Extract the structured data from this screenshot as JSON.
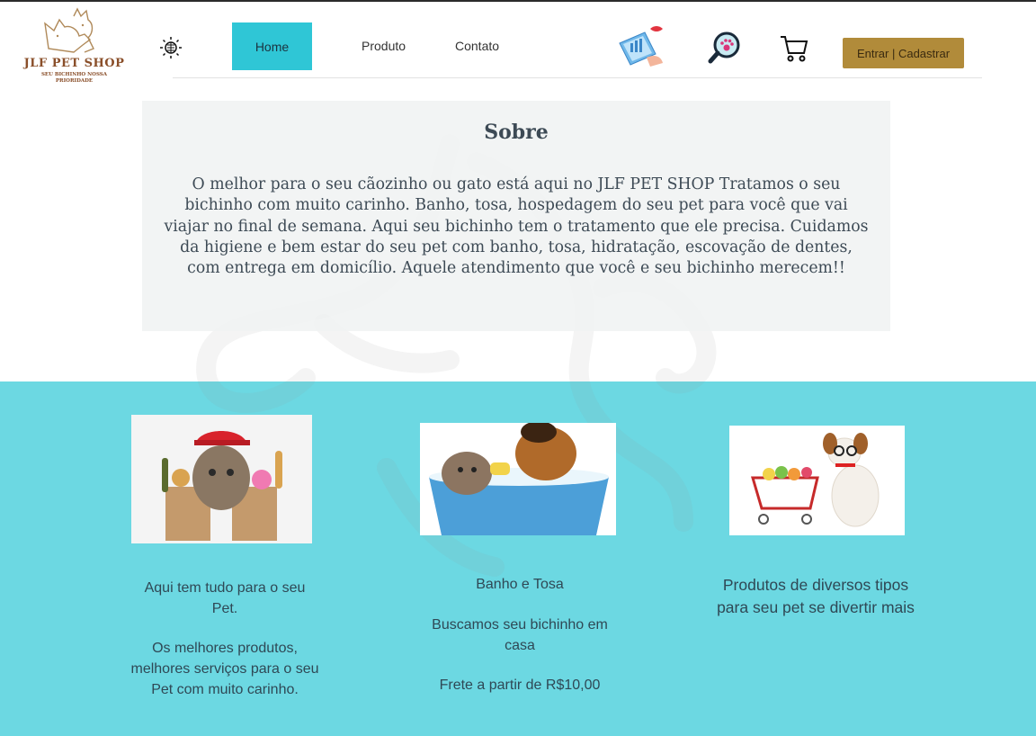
{
  "header": {
    "logo_title": "JLF PET SHOP",
    "logo_tagline": "SEU BICHINHO NOSSA PRIORIDADE",
    "nav": {
      "home": "Home",
      "produto": "Produto",
      "contato": "Contato"
    },
    "login_label": "Entrar | Cadastrar",
    "icons": [
      "sun-icon",
      "phone-promo-icon",
      "paw-search-icon",
      "cart-icon"
    ]
  },
  "sobre": {
    "title": "Sobre",
    "text": "O melhor para o seu cãozinho ou gato está aqui no JLF PET SHOP Tratamos o seu bichinho com muito carinho. Banho, tosa, hospedagem do seu pet para você que vai viajar no final de semana. Aqui seu bichinho tem o tratamento que ele precisa. Cuidamos da higiene e bem estar do seu pet com banho, tosa, hidratação, escovação de dentes, com entrega em domicílio. Aquele atendimento que você e seu bichinho merecem!!"
  },
  "cards": [
    {
      "heading": "Aqui tem tudo para o seu Pet.",
      "body": "Os melhores produtos, melhores serviços para o seu Pet com muito carinho."
    },
    {
      "heading": "Banho e Tosa",
      "body": "Buscamos seu bichinho em casa",
      "extra": "Frete a partir de R$10,00"
    },
    {
      "heading": "Produtos de diversos tipos para seu pet se divertir mais"
    }
  ],
  "colors": {
    "accent_teal": "#2fc6d6",
    "band_teal": "#6cd8e2",
    "button_gold": "#b18b3a",
    "brand_brown": "#8a4f2a"
  }
}
